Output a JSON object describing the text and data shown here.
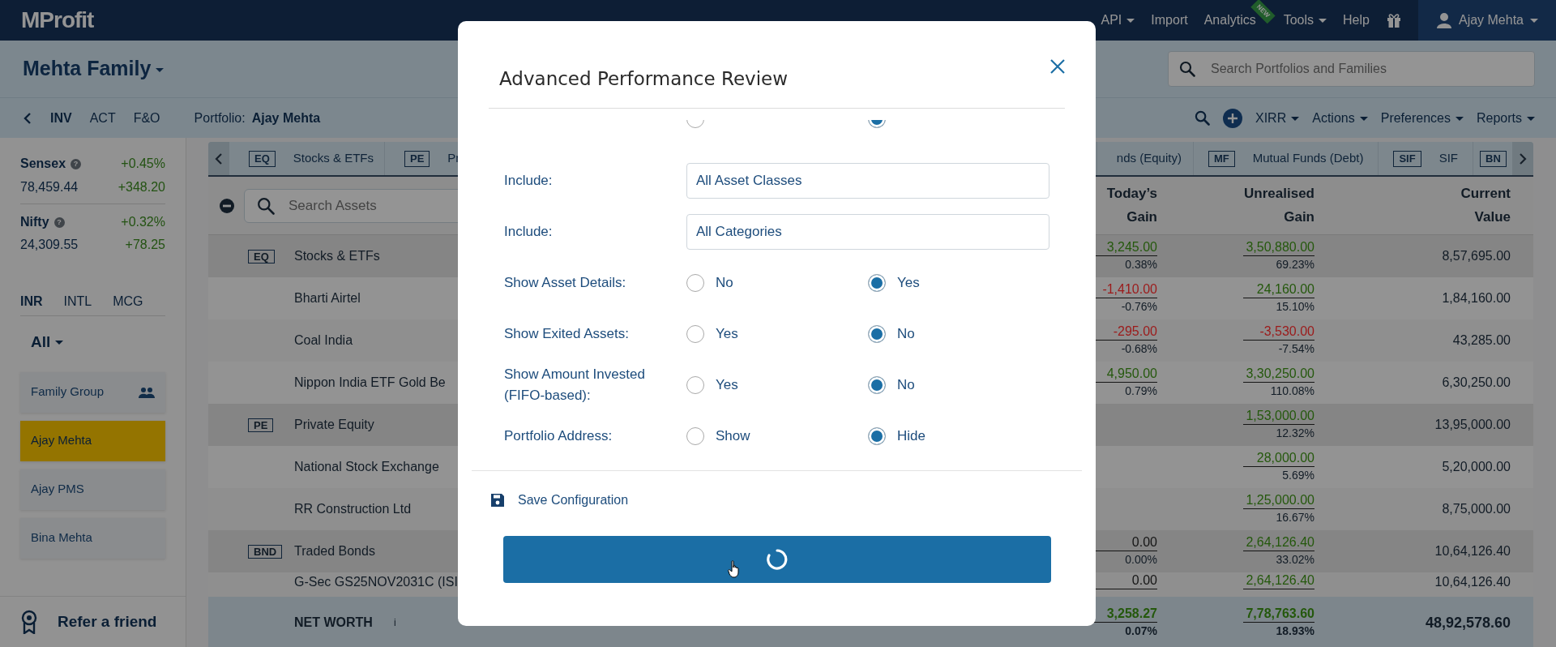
{
  "navbar": {
    "logo": "MProfit",
    "items": [
      {
        "label": "API",
        "caret": true
      },
      {
        "label": "Import",
        "caret": false
      },
      {
        "label": "Analytics",
        "caret": false,
        "badge": "NEW"
      },
      {
        "label": "Tools",
        "caret": true
      },
      {
        "label": "Help",
        "caret": false
      }
    ],
    "user": {
      "name": "Ajay Mehta",
      "caret": true
    }
  },
  "header": {
    "family": "Mehta Family",
    "search_placeholder": "Search Portfolios and Families"
  },
  "subnav": {
    "tabs": [
      {
        "label": "INV",
        "selected": true
      },
      {
        "label": "ACT",
        "selected": false
      },
      {
        "label": "F&O",
        "selected": false
      }
    ],
    "portfolio_label": "Portfolio:",
    "portfolio_name": "Ajay Mehta",
    "menus": [
      "XIRR",
      "Actions",
      "Preferences",
      "Reports"
    ]
  },
  "sidebar": {
    "indices": [
      {
        "name": "Sensex",
        "hint": "?",
        "change_pct": "+0.45%",
        "value": "78,459.44",
        "change": "+348.20"
      },
      {
        "name": "Nifty",
        "hint": "?",
        "change_pct": "+0.32%",
        "value": "24,309.55",
        "change": "+78.25"
      }
    ],
    "currency_tabs": [
      {
        "label": "INR",
        "selected": true
      },
      {
        "label": "INTL",
        "selected": false
      },
      {
        "label": "MCG",
        "selected": false
      }
    ],
    "filter": "All",
    "portfolios": [
      {
        "name": "Family Group",
        "kind": "group",
        "selected": false
      },
      {
        "name": "Ajay Mehta",
        "kind": "portfolio",
        "selected": true
      },
      {
        "name": "Ajay PMS",
        "kind": "portfolio",
        "selected": false
      },
      {
        "name": "Bina Mehta",
        "kind": "portfolio",
        "selected": false
      }
    ],
    "refer": "Refer a friend"
  },
  "asset_tabs": [
    {
      "code": "EQ",
      "label": "Stocks & ETFs"
    },
    {
      "code": "PE",
      "label": "Pr"
    },
    {
      "label": "nds (Equity)"
    },
    {
      "code": "MF",
      "label": "Mutual Funds (Debt)"
    },
    {
      "code": "SIF",
      "label": "SIF"
    },
    {
      "code": "BN"
    }
  ],
  "table": {
    "search_placeholder": "Search Assets",
    "columns": [
      "Today’s Gain",
      "Unrealised Gain",
      "Current Value"
    ],
    "rows": [
      {
        "kind": "group",
        "code": "EQ",
        "name": "Stocks & ETFs",
        "today": {
          "value": "3,245.00",
          "pct": "0.38%",
          "color": "#24580c"
        },
        "unrealised": {
          "value": "3,50,880.00",
          "pct": "69.23%",
          "color": "#24580c"
        },
        "current": "8,57,695.00"
      },
      {
        "kind": "asset",
        "name": "Bharti Airtel",
        "today": {
          "value": "-1,410.00",
          "pct": "-0.76%",
          "color": "#9c1a1a"
        },
        "unrealised": {
          "value": "24,160.00",
          "pct": "15.10%",
          "color": "#24580c"
        },
        "current": "1,84,160.00"
      },
      {
        "kind": "asset",
        "name": "Coal India",
        "today": {
          "value": "-295.00",
          "pct": "-0.68%",
          "color": "#9c1a1a"
        },
        "unrealised": {
          "value": "-3,530.00",
          "pct": "-7.54%",
          "color": "#9c1a1a"
        },
        "current": "43,285.00"
      },
      {
        "kind": "asset",
        "name": "Nippon India ETF Gold Be",
        "today": {
          "value": "4,950.00",
          "pct": "0.79%",
          "color": "#24580c"
        },
        "unrealised": {
          "value": "3,30,250.00",
          "pct": "110.08%",
          "color": "#24580c"
        },
        "current": "6,30,250.00"
      },
      {
        "kind": "group",
        "code": "PE",
        "name": "Private Equity",
        "unrealised": {
          "value": "1,53,000.00",
          "pct": "12.32%",
          "color": "#24580c"
        },
        "current": "13,95,000.00"
      },
      {
        "kind": "asset",
        "name": "National Stock Exchange",
        "unrealised": {
          "value": "28,000.00",
          "pct": "5.69%",
          "color": "#24580c"
        },
        "current": "5,20,000.00"
      },
      {
        "kind": "asset",
        "name": "RR Construction Ltd",
        "unrealised": {
          "value": "1,25,000.00",
          "pct": "16.67%",
          "color": "#24580c"
        },
        "current": "8,75,000.00"
      },
      {
        "kind": "group",
        "code": "BND",
        "name": "Traded Bonds",
        "today": {
          "value": "0.00",
          "pct": "0.00%",
          "color": "#151515"
        },
        "unrealised": {
          "value": "2,64,126.40",
          "pct": "33.02%",
          "color": "#24580c"
        },
        "current": "10,64,126.40"
      },
      {
        "kind": "partial",
        "name": "G-Sec GS25NOV2031C (ISI",
        "today": {
          "value": "0.00",
          "color": "#151515"
        },
        "unrealised": {
          "value": "2,64,126.40",
          "color": "#24580c"
        },
        "current": "10,64,126.40"
      }
    ],
    "total": {
      "name": "NET WORTH",
      "info": "i",
      "today": {
        "value": "3,258.27",
        "pct": "0.07%",
        "color": "#24580c"
      },
      "unrealised": {
        "value": "7,78,763.60",
        "pct": "18.93%",
        "color": "#24580c"
      },
      "current": "48,92,578.60"
    }
  },
  "modal": {
    "title": "Advanced Performance Review",
    "rows": [
      {
        "kind": "radio_partial",
        "options": [
          {
            "selected": false
          },
          {
            "selected": true
          }
        ]
      },
      {
        "kind": "select",
        "label": "Include:",
        "value": "All Asset Classes"
      },
      {
        "kind": "select",
        "label": "Include:",
        "value": "All Categories"
      },
      {
        "kind": "radio",
        "label": "Show Asset Details:",
        "options": [
          {
            "label": "No",
            "selected": false
          },
          {
            "label": "Yes",
            "selected": true
          }
        ]
      },
      {
        "kind": "radio",
        "label": "Show Exited Assets:",
        "options": [
          {
            "label": "Yes",
            "selected": false
          },
          {
            "label": "No",
            "selected": true
          }
        ]
      },
      {
        "kind": "radio",
        "label": "Show Amount Invested (FIFO-based):",
        "options": [
          {
            "label": "Yes",
            "selected": false
          },
          {
            "label": "No",
            "selected": true
          }
        ]
      },
      {
        "kind": "radio",
        "label": "Portfolio Address:",
        "options": [
          {
            "label": "Show",
            "selected": false
          },
          {
            "label": "Hide",
            "selected": true
          }
        ]
      }
    ],
    "save_label": "Save Configuration",
    "submit": {
      "loading": true
    }
  }
}
